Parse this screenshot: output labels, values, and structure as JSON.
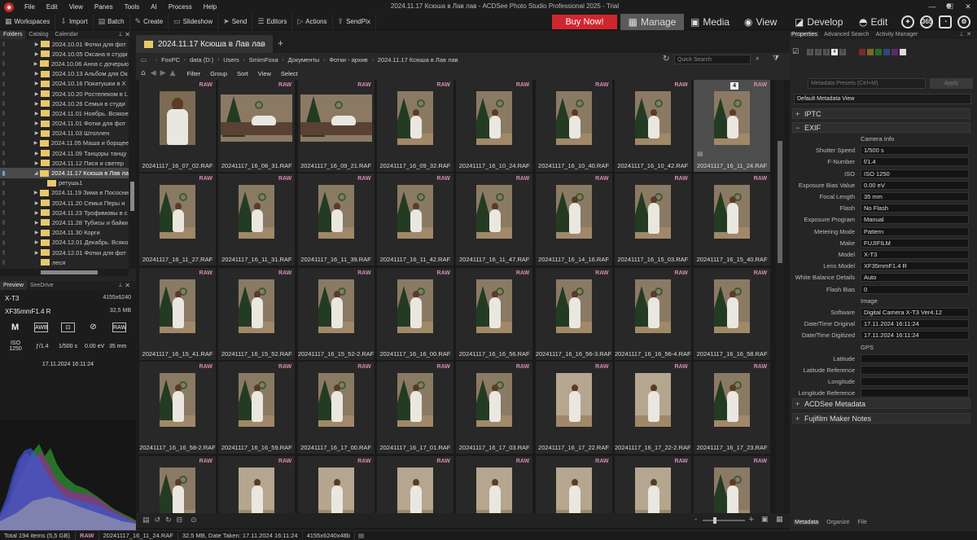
{
  "app": {
    "title": "2024.11.17 Ксюша в Лав лав - ACDSee Photo Studio Professional 2025 - Trial",
    "menu": [
      "File",
      "Edit",
      "View",
      "Panes",
      "Tools",
      "AI",
      "Process",
      "Help"
    ]
  },
  "toolbar": {
    "items": [
      {
        "icon": "grid-icon",
        "label": "Workspaces"
      },
      {
        "icon": "import-icon",
        "label": "Import"
      },
      {
        "icon": "batch-icon",
        "label": "Batch"
      },
      {
        "icon": "create-icon",
        "label": "Create"
      },
      {
        "icon": "slideshow-icon",
        "label": "Slideshow"
      },
      {
        "icon": "send-icon",
        "label": "Send"
      },
      {
        "icon": "editors-icon",
        "label": "Editors"
      },
      {
        "icon": "actions-icon",
        "label": "Actions"
      },
      {
        "icon": "sendpix-icon",
        "label": "SendPix"
      }
    ],
    "buy_now": "Buy Now!",
    "modes": [
      {
        "icon": "manage-icon",
        "label": "Manage",
        "active": true
      },
      {
        "icon": "media-icon",
        "label": "Media"
      },
      {
        "icon": "view-icon",
        "label": "View"
      },
      {
        "icon": "develop-icon",
        "label": "Develop"
      },
      {
        "icon": "edit-icon",
        "label": "Edit"
      }
    ],
    "extra_icons": [
      "365"
    ]
  },
  "folders_panel": {
    "tabs": [
      "Folders",
      "Catalog",
      "Calendar"
    ],
    "items": [
      {
        "label": "2024.10.01 Фотки для фот",
        "type": "folder"
      },
      {
        "label": "2024.10.05 Оксана в студи",
        "type": "folder"
      },
      {
        "label": "2024.10.06 Анна с дочерью",
        "type": "folder"
      },
      {
        "label": "2024.10.13 Альбом для Ок",
        "type": "folder"
      },
      {
        "label": "2024.10.16 Покатушки в Х",
        "type": "folder"
      },
      {
        "label": "2024.10.20 Ростелеком в L",
        "type": "folder"
      },
      {
        "label": "2024.10.26 Семья в студи",
        "type": "folder"
      },
      {
        "label": "2024.11.01 Ноябрь. Всякое",
        "type": "folder"
      },
      {
        "label": "2024.11.01 Фотки для фот",
        "type": "folder"
      },
      {
        "label": "2024.11.03 Штоллен",
        "type": "folder"
      },
      {
        "label": "2024.11.05 Маша и борщее",
        "type": "folder"
      },
      {
        "label": "2024.11.09 Танцоры танцу",
        "type": "folder"
      },
      {
        "label": "2024.11.12 Пися и светер",
        "type": "folder"
      },
      {
        "label": "2024.11.17 Ксюша в Лав ла",
        "type": "folder",
        "selected": true
      },
      {
        "label": "ретушь1",
        "type": "subfolder"
      },
      {
        "label": "2024.11.19 Зима в Пососни",
        "type": "folder"
      },
      {
        "label": "2024.11.20 Семья Перы и",
        "type": "folder"
      },
      {
        "label": "2024.11.23 Трофимовы в с",
        "type": "folder"
      },
      {
        "label": "2024.11.28 Тубисы и байки",
        "type": "folder"
      },
      {
        "label": "2024.11.30 Корги",
        "type": "folder"
      },
      {
        "label": "2024.12.01 Декабрь. Всяко",
        "type": "folder"
      },
      {
        "label": "2024.12.01 Фотки для фот",
        "type": "folder"
      },
      {
        "label": "леся",
        "type": "folder"
      }
    ]
  },
  "preview_panel": {
    "tabs": [
      "Preview",
      "SeeDrive"
    ],
    "camera": "X-T3",
    "dimensions": "4155x6240",
    "lens": "XF35mmF1.4 R",
    "size": "32,5 MB",
    "mode": "M",
    "awb": "AWB",
    "raw": "RAW",
    "iso": "ISO 1250",
    "aperture": "ƒ/1.4",
    "shutter": "1/500 s",
    "ev": "0.00 eV",
    "focal": "35 mm",
    "datetime": "17.11.2024 16:11:24"
  },
  "file_list": {
    "tab_title": "2024.11.17 Ксюша в Лав лав",
    "breadcrumb": [
      "FoxPC",
      "data (D:)",
      "Users",
      "SmimFoxa",
      "Документы",
      "Фотки - архив",
      "2024.11.17 Ксюша в Лав лав"
    ],
    "quick_search_placeholder": "Quick Search",
    "filter_bar": [
      "Filter",
      "Group",
      "Sort",
      "View",
      "Select"
    ],
    "raw_badge": "RAW",
    "tiles": [
      {
        "name": "20241117_16_07_02.RAF",
        "scene": "portrait"
      },
      {
        "name": "20241117_16_08_31.RAF",
        "scene": "sofa"
      },
      {
        "name": "20241117_16_09_21.RAF",
        "scene": "sofa"
      },
      {
        "name": "20241117_16_09_32.RAF",
        "scene": "sit"
      },
      {
        "name": "20241117_16_10_24.RAF",
        "scene": "sit"
      },
      {
        "name": "20241117_16_10_40.RAF",
        "scene": "sit"
      },
      {
        "name": "20241117_16_10_42.RAF",
        "scene": "sit"
      },
      {
        "name": "20241117_16_11_24.RAF",
        "scene": "sit",
        "selected": true,
        "badge": "4"
      },
      {
        "name": "20241117_16_11_27.RAF",
        "scene": "sit"
      },
      {
        "name": "20241117_16_11_31.RAF",
        "scene": "sit"
      },
      {
        "name": "20241117_16_11_39.RAF",
        "scene": "sit"
      },
      {
        "name": "20241117_16_11_42.RAF",
        "scene": "sit"
      },
      {
        "name": "20241117_16_11_47.RAF",
        "scene": "sit"
      },
      {
        "name": "20241117_16_14_16.RAF",
        "scene": "stand"
      },
      {
        "name": "20241117_16_15_03.RAF",
        "scene": "stand"
      },
      {
        "name": "20241117_16_15_40.RAF",
        "scene": "stand"
      },
      {
        "name": "20241117_16_15_41.RAF",
        "scene": "stand"
      },
      {
        "name": "20241117_16_15_52.RAF",
        "scene": "stand"
      },
      {
        "name": "20241117_16_15_52-2.RAF",
        "scene": "stand"
      },
      {
        "name": "20241117_16_16_00.RAF",
        "scene": "stand"
      },
      {
        "name": "20241117_16_16_56.RAF",
        "scene": "stand"
      },
      {
        "name": "20241117_16_16_56-3.RAF",
        "scene": "stand"
      },
      {
        "name": "20241117_16_16_56-4.RAF",
        "scene": "stand"
      },
      {
        "name": "20241117_16_16_58.RAF",
        "scene": "stand"
      },
      {
        "name": "20241117_16_16_58-2.RAF",
        "scene": "stand"
      },
      {
        "name": "20241117_16_16_59.RAF",
        "scene": "stand"
      },
      {
        "name": "20241117_16_17_00.RAF",
        "scene": "stand"
      },
      {
        "name": "20241117_16_17_01.RAF",
        "scene": "stand"
      },
      {
        "name": "20241117_16_17_03.RAF",
        "scene": "stand"
      },
      {
        "name": "20241117_16_17_22.RAF",
        "scene": "pale"
      },
      {
        "name": "20241117_16_17_22-2.RAF",
        "scene": "pale"
      },
      {
        "name": "20241117_16_17_23.RAF",
        "scene": "stand"
      },
      {
        "name": "",
        "scene": "stand"
      },
      {
        "name": "",
        "scene": "pale"
      },
      {
        "name": "",
        "scene": "pale"
      },
      {
        "name": "",
        "scene": "pale"
      },
      {
        "name": "",
        "scene": "pale"
      },
      {
        "name": "",
        "scene": "pale"
      },
      {
        "name": "",
        "scene": "pale"
      },
      {
        "name": "",
        "scene": "stand"
      }
    ]
  },
  "properties_panel": {
    "tabs": [
      "Properties",
      "Advanced Search",
      "Activity Manager"
    ],
    "rating_boxes": [
      "1",
      "2",
      "3",
      "4",
      "5"
    ],
    "selected_rating": "4",
    "label_colors": [
      "#7a2a2a",
      "#7a6a2a",
      "#2a6a2a",
      "#2a4a7a",
      "#5a2a6a"
    ],
    "metadata_presets_placeholder": "Metadata Presets (Ctrl+M)",
    "apply": "Apply",
    "metadata_view": "Default Metadata View",
    "sections": {
      "iptc": "IPTC",
      "exif": "EXIF",
      "acdsee": "ACDSee Metadata",
      "maker": "Fujifilm Maker Notes"
    },
    "exif_rows": [
      {
        "label": "",
        "value": "Camera Info",
        "kind": "caption"
      },
      {
        "label": "Shutter Speed",
        "value": "1/500 s"
      },
      {
        "label": "F-Number",
        "value": "f/1.4"
      },
      {
        "label": "ISO",
        "value": "ISO 1250"
      },
      {
        "label": "Exposure Bias Value",
        "value": "0.00 eV"
      },
      {
        "label": "Focal Length",
        "value": "35 mm"
      },
      {
        "label": "Flash",
        "value": "No Flash"
      },
      {
        "label": "Exposure Program",
        "value": "Manual"
      },
      {
        "label": "Metering Mode",
        "value": "Pattern"
      },
      {
        "label": "Make",
        "value": "FUJIFILM"
      },
      {
        "label": "Model",
        "value": "X-T3"
      },
      {
        "label": "Lens Model",
        "value": "XF35mmF1.4 R"
      },
      {
        "label": "White Balance Details",
        "value": "Auto"
      },
      {
        "label": "Flash Bias",
        "value": "0"
      },
      {
        "label": "",
        "value": "Image",
        "kind": "caption"
      },
      {
        "label": "Software",
        "value": "Digital Camera X-T3 Ver4.12"
      },
      {
        "label": "Date/Time Original",
        "value": "17.11.2024 16:11:24"
      },
      {
        "label": "Date/Time Digitized",
        "value": "17.11.2024 16:11:24"
      },
      {
        "label": "",
        "value": "GPS",
        "kind": "caption"
      },
      {
        "label": "Latitude",
        "value": ""
      },
      {
        "label": "Latitude Reference",
        "value": ""
      },
      {
        "label": "Longitude",
        "value": ""
      },
      {
        "label": "Longitude Reference",
        "value": ""
      }
    ],
    "bottom_tabs": [
      "Metadata",
      "Organize",
      "File"
    ]
  },
  "status_bar": {
    "total": "Total 194 items  (5,5 GB)",
    "raw": "RAW",
    "filename": "20241117_16_11_24.RAF",
    "info": "32,5 MB, Date Taken: 17.11.2024 16:11:24",
    "dims": "4155x6240x48b"
  },
  "colors": {
    "accent": "#d0262e",
    "raw_badge": "#d78ab4",
    "folder": "#e8c86c"
  }
}
